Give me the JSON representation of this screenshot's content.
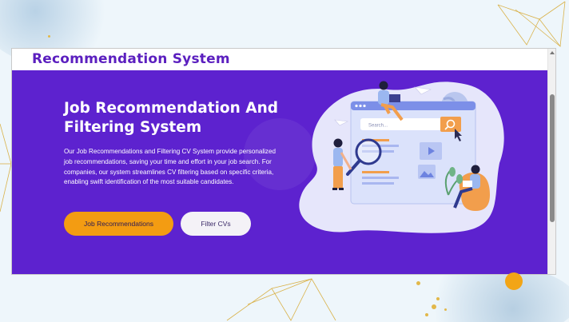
{
  "header": {
    "brand": "Recommendation System"
  },
  "hero": {
    "title_line1": "Job Recommendation And",
    "title_line2": "Filtering System",
    "description": "Our Job Recommendations and Filtering CV System provide personalized job recommendations, saving your time and effort in your job search. For companies, our system streamlines CV filtering based on specific criteria, enabling swift identification of the most suitable candidates.",
    "primary_button": "Job Recommendations",
    "secondary_button": "Filter CVs",
    "illustration": {
      "search_placeholder": "Search..."
    }
  },
  "colors": {
    "brand": "#5b1fbf",
    "hero_bg": "#5d22cf",
    "primary_button": "#f39c12",
    "secondary_button": "#f4f2f7"
  },
  "icons": [
    "search-icon",
    "play-icon",
    "image-icon",
    "cursor-icon",
    "magnifier-icon",
    "paper-plane-icon",
    "globe-icon",
    "chat-icon",
    "scroll-up-icon"
  ]
}
